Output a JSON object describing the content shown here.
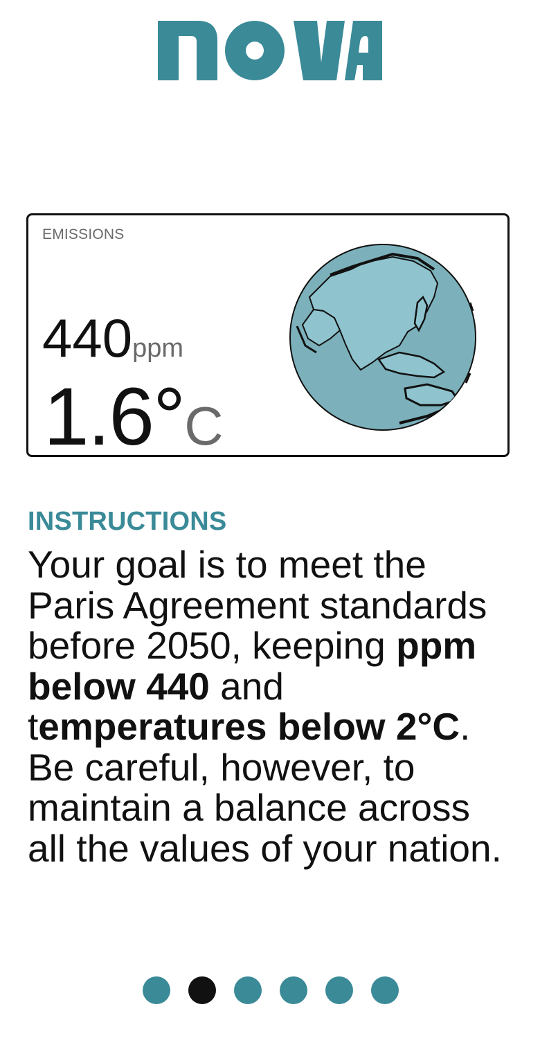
{
  "brand": {
    "logo_text": "nova",
    "accent_color": "#3a8a98"
  },
  "emissions_card": {
    "label": "EMISSIONS",
    "ppm_value": "440",
    "ppm_unit": "ppm",
    "temp_value": "1.6°",
    "temp_unit": "C",
    "globe_icon": "globe-asia-icon"
  },
  "instructions": {
    "title": "INSTRUCTIONS",
    "text_1": "Your goal is to meet the Paris Agreement standards before 2050, keeping ",
    "bold_1": "ppm below 440",
    "text_2": " and t",
    "bold_2": "emperatures below 2°C",
    "text_3": ". Be careful, however, to maintain a balance across all the values of your nation."
  },
  "pagination": {
    "total_pages": 6,
    "active_page": 2,
    "active_color": "#111111",
    "inactive_color": "#3a8a98"
  }
}
